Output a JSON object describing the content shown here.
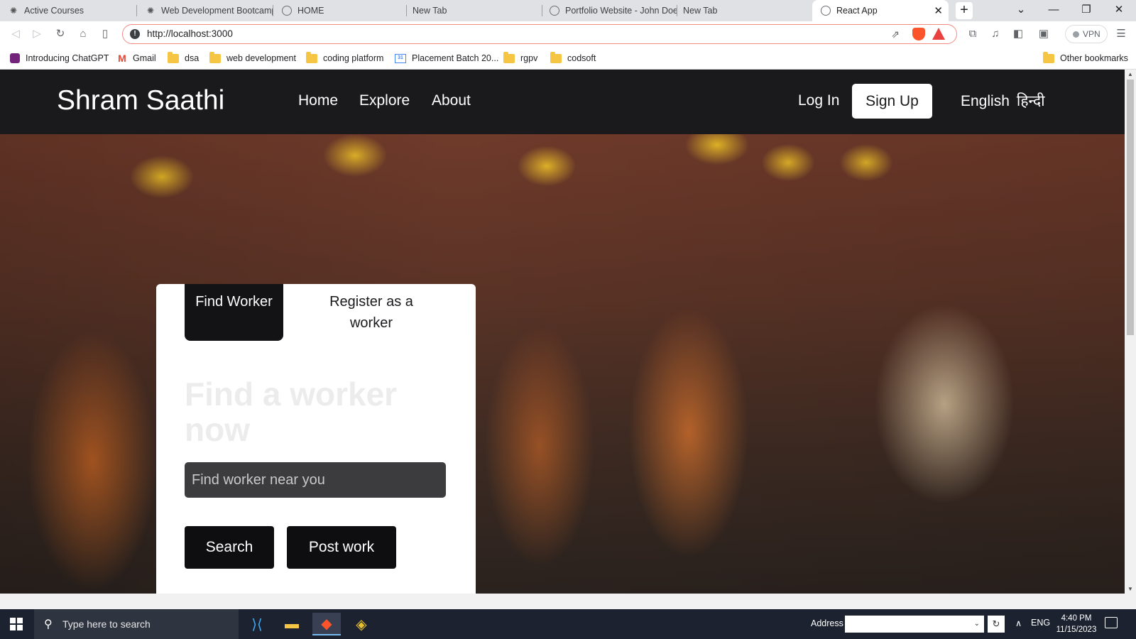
{
  "browser": {
    "tabs": [
      {
        "label": "Active Courses",
        "icon": "web-icon"
      },
      {
        "label": "Web Development Bootcamp",
        "icon": "web-icon"
      },
      {
        "label": "HOME",
        "icon": "globe-icon"
      },
      {
        "label": "New Tab",
        "icon": ""
      },
      {
        "label": "Portfolio Website - John Doe",
        "icon": "globe-icon"
      },
      {
        "label": "New Tab",
        "icon": ""
      },
      {
        "label": "React App",
        "icon": "globe-icon",
        "active": true
      }
    ],
    "url": "http://localhost:3000",
    "vpn_label": "VPN",
    "bookmarks": [
      {
        "label": "Introducing ChatGPT",
        "icon": "chatgpt-icon"
      },
      {
        "label": "Gmail",
        "icon": "gmail-icon"
      },
      {
        "label": "dsa",
        "icon": "folder-icon"
      },
      {
        "label": "web development",
        "icon": "folder-icon"
      },
      {
        "label": "coding platform",
        "icon": "folder-icon"
      },
      {
        "label": "Placement Batch 20...",
        "icon": "calendar-icon"
      },
      {
        "label": "rgpv",
        "icon": "folder-icon"
      },
      {
        "label": "codsoft",
        "icon": "folder-icon"
      }
    ],
    "other_bookmarks": "Other bookmarks"
  },
  "navbar": {
    "brand": "Shram Saathi",
    "links": [
      "Home",
      "Explore",
      "About"
    ],
    "login": "Log In",
    "signup": "Sign Up",
    "lang_en": "English",
    "lang_hi": "हिन्दी"
  },
  "card": {
    "tab_find": "Find Worker",
    "tab_register": "Register as a worker",
    "heading": "Find a worker now",
    "search_placeholder": "Find worker near you",
    "search_button": "Search",
    "post_button": "Post work"
  },
  "taskbar": {
    "search_placeholder": "Type here to search",
    "address_label": "Address",
    "language": "ENG",
    "time": "4:40 PM",
    "date": "11/15/2023"
  },
  "colors": {
    "navbar_bg": "#1a1a1d",
    "card_bg": "#ffffff",
    "input_bg": "#3c3c3e",
    "button_bg": "#0e0e10"
  }
}
